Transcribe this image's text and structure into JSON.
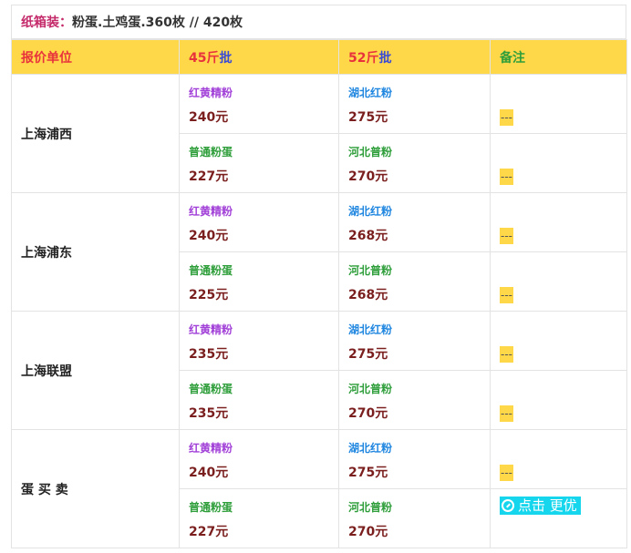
{
  "title": {
    "lead": "纸箱装：",
    "rest": "粉蛋.土鸡蛋.360枚 // 420枚"
  },
  "header": {
    "col1": "报价单位",
    "col2_num": "45斤",
    "col2_unit": "批",
    "col3_num": "52斤",
    "col3_unit": "批",
    "col4": "备注"
  },
  "groups": [
    {
      "location": "上海浦西",
      "rows": [
        {
          "c2_name": "红黄精粉",
          "c2_price": "240元",
          "c3_name": "湖北红粉",
          "c3_price": "275元",
          "note": "---"
        },
        {
          "c2_name": "普通粉蛋",
          "c2_price": "227元",
          "c3_name": "河北普粉",
          "c3_price": "270元",
          "note": "---"
        }
      ]
    },
    {
      "location": "上海浦东",
      "rows": [
        {
          "c2_name": "红黄精粉",
          "c2_price": "240元",
          "c3_name": "湖北红粉",
          "c3_price": "268元",
          "note": "---"
        },
        {
          "c2_name": "普通粉蛋",
          "c2_price": "225元",
          "c3_name": "河北普粉",
          "c3_price": "268元",
          "note": "---"
        }
      ]
    },
    {
      "location": "上海联盟",
      "rows": [
        {
          "c2_name": "红黄精粉",
          "c2_price": "235元",
          "c3_name": "湖北红粉",
          "c3_price": "275元",
          "note": "---"
        },
        {
          "c2_name": "普通粉蛋",
          "c2_price": "235元",
          "c3_name": "河北普粉",
          "c3_price": "270元",
          "note": "---"
        }
      ]
    },
    {
      "location": "蛋 买 卖",
      "rows": [
        {
          "c2_name": "红黄精粉",
          "c2_price": "240元",
          "c3_name": "湖北红粉",
          "c3_price": "275元",
          "note": "---"
        },
        {
          "c2_name": "普通粉蛋",
          "c2_price": "227元",
          "c3_name": "河北普粉",
          "c3_price": "270元",
          "note_button": "点击 更优"
        }
      ]
    }
  ],
  "colors": {
    "header_bg": "#ffd84a",
    "button_bg": "#16d6ee"
  }
}
